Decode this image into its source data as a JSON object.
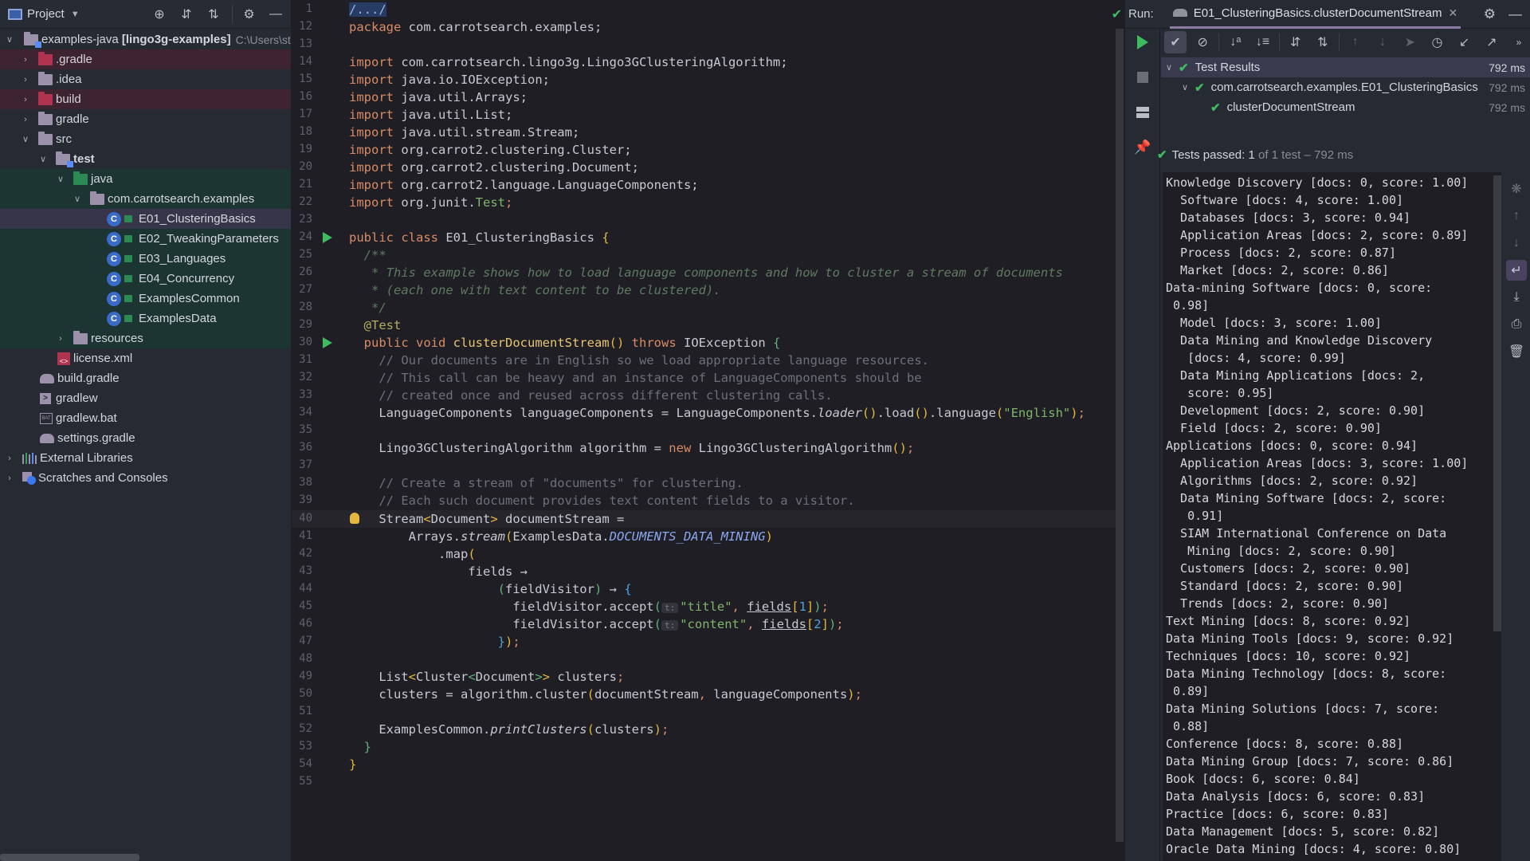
{
  "project_panel": {
    "title": "Project",
    "tree": [
      {
        "label": "examples-java",
        "suffix": "[lingo3g-examples]",
        "path": "C:\\Users\\st",
        "icon": "module-folder-icon"
      },
      {
        "label": ".gradle",
        "icon": "excluded-folder-icon"
      },
      {
        "label": ".idea",
        "icon": "folder-icon"
      },
      {
        "label": "build",
        "icon": "excluded-folder-icon"
      },
      {
        "label": "gradle",
        "icon": "folder-icon"
      },
      {
        "label": "src",
        "icon": "folder-icon"
      },
      {
        "label": "test",
        "icon": "module-folder-icon"
      },
      {
        "label": "java",
        "icon": "test-source-folder-icon"
      },
      {
        "label": "com.carrotsearch.examples",
        "icon": "package-icon"
      },
      {
        "label": "E01_ClusteringBasics",
        "icon": "java-class-icon"
      },
      {
        "label": "E02_TweakingParameters",
        "icon": "java-class-icon"
      },
      {
        "label": "E03_Languages",
        "icon": "java-class-icon"
      },
      {
        "label": "E04_Concurrency",
        "icon": "java-class-icon"
      },
      {
        "label": "ExamplesCommon",
        "icon": "java-class-icon"
      },
      {
        "label": "ExamplesData",
        "icon": "java-class-icon"
      },
      {
        "label": "resources",
        "icon": "resources-folder-icon"
      },
      {
        "label": "license.xml",
        "icon": "xml-file-icon"
      },
      {
        "label": "build.gradle",
        "icon": "gradle-file-icon"
      },
      {
        "label": "gradlew",
        "icon": "shell-script-icon"
      },
      {
        "label": "gradlew.bat",
        "icon": "bat-file-icon"
      },
      {
        "label": "settings.gradle",
        "icon": "gradle-file-icon"
      },
      {
        "label": "External Libraries",
        "icon": "libraries-icon"
      },
      {
        "label": "Scratches and Consoles",
        "icon": "scratches-icon"
      }
    ],
    "class_icon_letter": "C"
  },
  "editor": {
    "line_numbers": [
      "1",
      "12",
      "13",
      "14",
      "15",
      "16",
      "17",
      "18",
      "19",
      "20",
      "21",
      "22",
      "23",
      "24",
      "25",
      "26",
      "27",
      "28",
      "29",
      "30",
      "31",
      "32",
      "33",
      "34",
      "35",
      "36",
      "37",
      "38",
      "39",
      "40",
      "41",
      "42",
      "43",
      "44",
      "45",
      "46",
      "47",
      "48",
      "49",
      "50",
      "51",
      "52",
      "53",
      "54",
      "55"
    ],
    "folded_header": "/.../",
    "package_kw": "package",
    "package_name": "com.carrotsearch.examples;",
    "import_kw": "import",
    "imports": [
      "com.carrotsearch.lingo3g.Lingo3GClusteringAlgorithm;",
      "java.io.IOException;",
      "java.util.Arrays;",
      "java.util.List;",
      "java.util.stream.Stream;",
      "org.carrot2.clustering.Cluster;",
      "org.carrot2.clustering.Document;",
      "org.carrot2.language.LanguageComponents;"
    ],
    "import_junit_prefix": "org.junit.",
    "import_junit_class": "Test",
    "import_junit_semi": ";",
    "class_decl_kw": "public class",
    "class_name": "E01_ClusteringBasics",
    "javadoc": [
      "/**",
      " * This example shows how to load language components and how to cluster a stream of documents",
      " * (each one with text content to be clustered).",
      " */"
    ],
    "annotation": "@Test",
    "method_kw": "public void",
    "method_name": "clusterDocumentStream",
    "throws_kw": "throws",
    "throws_type": "IOException",
    "comments_1": [
      "// Our documents are in English so we load appropriate language resources.",
      "// This call can be heavy and an instance of LanguageComponents should be",
      "// created once and reused across different clustering calls."
    ],
    "lc_decl": "LanguageComponents languageComponents = LanguageComponents.",
    "lc_loader": "loader",
    "lc_load": ".load",
    "lc_language": ".language",
    "lc_lang_arg": "\"English\"",
    "alg_decl": "Lingo3GClusteringAlgorithm algorithm = ",
    "alg_new": "new",
    "alg_ctor": " Lingo3GClusteringAlgorithm",
    "comments_2": [
      "// Create a stream of \"documents\" for clustering.",
      "// Each such document provides text content fields to a visitor."
    ],
    "stream_type": "Stream",
    "stream_generic": "Document",
    "stream_var": " documentStream =",
    "arrays": "Arrays.",
    "arrays_stream": "stream",
    "examples_data": "ExamplesData.",
    "docs_const": "DOCUMENTS_DATA_MINING",
    "map_call": ".map",
    "fields_lambda": "fields →",
    "visitor_param": "fieldVisitor",
    "arrow": " → ",
    "accept_call": "fieldVisitor.accept",
    "param_hint": "t:",
    "title_str": "\"title\"",
    "content_str": "\"content\"",
    "fields_ref": "fields",
    "idx_1": "1",
    "idx_2": "2",
    "list_decl_type": "List",
    "list_decl_cluster": "Cluster",
    "list_decl_doc": "Document",
    "list_decl_var": " clusters",
    "cluster_assign": "clusters = algorithm.cluster",
    "cluster_args_1": "documentStream",
    "cluster_args_2": " languageComponents",
    "print_prefix": "ExamplesCommon.",
    "print_fn": "printClusters",
    "print_arg": "clusters",
    "inspection_status": "ok"
  },
  "run_panel": {
    "label": "Run:",
    "tab_title": "E01_ClusteringBasics.clusterDocumentStream",
    "test_tree": [
      {
        "label": "Test Results",
        "time": "792 ms"
      },
      {
        "label": "com.carrotsearch.examples.E01_ClusteringBasics",
        "time": "792 ms"
      },
      {
        "label": "clusterDocumentStream",
        "time": "792 ms"
      }
    ],
    "status_main": "Tests passed: 1",
    "status_detail": " of 1 test – 792 ms",
    "console_lines": [
      "Knowledge Discovery [docs: 0, score: 1.00]",
      "  Software [docs: 4, score: 1.00]",
      "  Databases [docs: 3, score: 0.94]",
      "  Application Areas [docs: 2, score: 0.89]",
      "  Process [docs: 2, score: 0.87]",
      "  Market [docs: 2, score: 0.86]",
      "Data-mining Software [docs: 0, score:",
      " 0.98]",
      "  Model [docs: 3, score: 1.00]",
      "  Data Mining and Knowledge Discovery",
      "   [docs: 4, score: 0.99]",
      "  Data Mining Applications [docs: 2,",
      "   score: 0.95]",
      "  Development [docs: 2, score: 0.90]",
      "  Field [docs: 2, score: 0.90]",
      "Applications [docs: 0, score: 0.94]",
      "  Application Areas [docs: 3, score: 1.00]",
      "  Algorithms [docs: 2, score: 0.92]",
      "  Data Mining Software [docs: 2, score:",
      "   0.91]",
      "  SIAM International Conference on Data",
      "   Mining [docs: 2, score: 0.90]",
      "  Customers [docs: 2, score: 0.90]",
      "  Standard [docs: 2, score: 0.90]",
      "  Trends [docs: 2, score: 0.90]",
      "Text Mining [docs: 8, score: 0.92]",
      "Data Mining Tools [docs: 9, score: 0.92]",
      "Techniques [docs: 10, score: 0.92]",
      "Data Mining Technology [docs: 8, score:",
      " 0.89]",
      "Data Mining Solutions [docs: 7, score:",
      " 0.88]",
      "Conference [docs: 8, score: 0.88]",
      "Data Mining Group [docs: 7, score: 0.86]",
      "Book [docs: 6, score: 0.84]",
      "Data Analysis [docs: 6, score: 0.83]",
      "Practice [docs: 6, score: 0.83]",
      "Data Management [docs: 5, score: 0.82]",
      "Oracle Data Mining [docs: 4, score: 0.80]"
    ]
  },
  "colors": {
    "accent_green": "#3dbb5e",
    "excluded_red": "#b0344f",
    "selection": "#373549"
  }
}
